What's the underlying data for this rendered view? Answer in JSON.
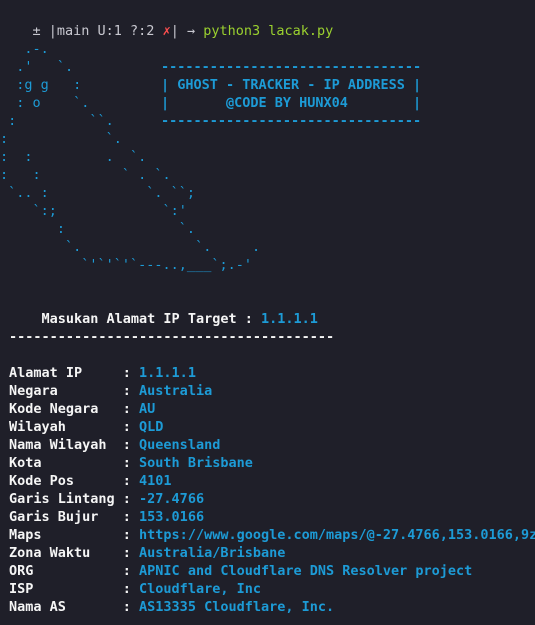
{
  "prompt": {
    "git_status": "± |main U:1 ?:2 ",
    "dirty_mark": "✗",
    "after_mark": "| ",
    "arrow": "→ ",
    "command": "python3 lacak.py"
  },
  "ascii_art": [
    "   .-.",
    "  .'   `.",
    "  :g g   :",
    "  : o    `.",
    " :         ``.",
    ":            `.",
    ":  :         .  `.",
    ":   :          ` . `.",
    " `.. :            `. ``;",
    "    `:;             `:'",
    "       :              `.",
    "        `.              `.     .",
    "          `'`'`'`---..,___`;.-'"
  ],
  "banner": {
    "border": "--------------------------------",
    "title": "| GHOST - TRACKER - IP ADDRESS |",
    "credit": "|       @CODE BY HUNX04        |"
  },
  "input": {
    "label": "Masukan Alamat IP Target : ",
    "value": "1.1.1.1"
  },
  "separator": "----------------------------------------",
  "results": [
    {
      "label": "Alamat IP     : ",
      "value": "1.1.1.1"
    },
    {
      "label": "Negara        : ",
      "value": "Australia"
    },
    {
      "label": "Kode Negara   : ",
      "value": "AU"
    },
    {
      "label": "Wilayah       : ",
      "value": "QLD"
    },
    {
      "label": "Nama Wilayah  : ",
      "value": "Queensland"
    },
    {
      "label": "Kota          : ",
      "value": "South Brisbane"
    },
    {
      "label": "Kode Pos      : ",
      "value": "4101"
    },
    {
      "label": "Garis Lintang : ",
      "value": "-27.4766"
    },
    {
      "label": "Garis Bujur   : ",
      "value": "153.0166"
    },
    {
      "label": "Maps          : ",
      "value": "https://www.google.com/maps/@-27.4766,153.0166,9z"
    },
    {
      "label": "Zona Waktu    : ",
      "value": "Australia/Brisbane"
    },
    {
      "label": "ORG           : ",
      "value": "APNIC and Cloudflare DNS Resolver project"
    },
    {
      "label": "ISP           : ",
      "value": "Cloudflare, Inc"
    },
    {
      "label": "Nama AS       : ",
      "value": "AS13335 Cloudflare, Inc."
    }
  ]
}
